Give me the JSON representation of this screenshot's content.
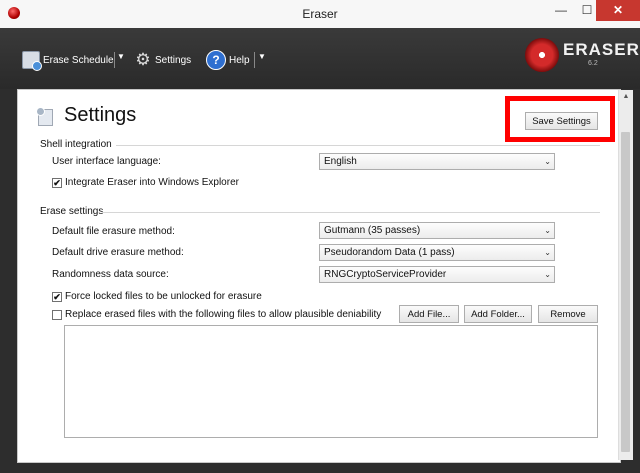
{
  "window": {
    "title": "Eraser",
    "close_glyph": "✕",
    "min_glyph": "—",
    "max_glyph": "☐"
  },
  "toolbar": {
    "erase_schedule": "Erase Schedule",
    "settings": "Settings",
    "help": "Help",
    "dropdown_glyph": "▼",
    "help_glyph": "?",
    "gear_glyph": "⚙"
  },
  "logo": {
    "name": "ERASER",
    "version": "6.2"
  },
  "page": {
    "title": "Settings",
    "save_button": "Save Settings"
  },
  "shell": {
    "header": "Shell integration",
    "language_label": "User interface language:",
    "language_value": "English",
    "integrate_label": "Integrate Eraser into Windows Explorer",
    "integrate_checked": true
  },
  "erase": {
    "header": "Erase settings",
    "file_method_label": "Default file erasure method:",
    "file_method_value": "Gutmann (35 passes)",
    "drive_method_label": "Default drive erasure method:",
    "drive_method_value": "Pseudorandom Data (1 pass)",
    "random_label": "Randomness data source:",
    "random_value": "RNGCryptoServiceProvider",
    "force_label": "Force locked files to be unlocked for erasure",
    "force_checked": true,
    "replace_label": "Replace erased files with the following files to allow plausible deniability",
    "replace_checked": false,
    "add_file": "Add File...",
    "add_folder": "Add Folder...",
    "remove": "Remove"
  },
  "check_glyph": "✔",
  "chevron_glyph": "⌄",
  "colors": {
    "accent_red": "#ff0000",
    "toolbar_bg": "#2d2d2d",
    "close_bg": "#c7372f"
  }
}
